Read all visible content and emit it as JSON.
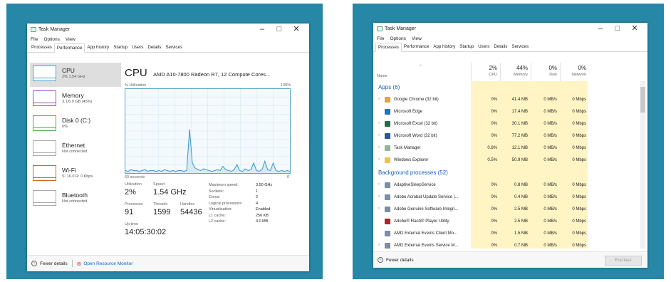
{
  "left": {
    "title": "Task Manager",
    "menu": [
      "File",
      "Options",
      "View"
    ],
    "tabs": [
      "Processes",
      "Performance",
      "App history",
      "Startup",
      "Users",
      "Details",
      "Services"
    ],
    "active_tab": "Performance",
    "sidebar": [
      {
        "name": "CPU",
        "sub": "2% 1.54 GHz",
        "color": "#4aa3d4"
      },
      {
        "name": "Memory",
        "sub": "3.1/6.9 GB (45%)",
        "color": "#a24dc4"
      },
      {
        "name": "Disk 0 (C:)",
        "sub": "0%",
        "color": "#4caf50"
      },
      {
        "name": "Ethernet",
        "sub": "Not connected",
        "color": "#aaaaaa"
      },
      {
        "name": "Wi-Fi",
        "sub": "S: 16.0 R: 0 Kbps",
        "color": "#d2691e"
      },
      {
        "name": "Bluetooth",
        "sub": "Not connected",
        "color": "#aaaaaa"
      }
    ],
    "main": {
      "title": "CPU",
      "model": "AMD A10-7800 Radeon R7, 12 Compute Cores...",
      "util_label": "% Utilization",
      "util_max": "100%",
      "time_label": "60 seconds",
      "time_end": "0",
      "utilization_label": "Utilization",
      "utilization": "2%",
      "speed_label": "Speed",
      "speed": "1.54 GHz",
      "processes_label": "Processes",
      "processes": "91",
      "threads_label": "Threads",
      "threads": "1599",
      "handles_label": "Handles",
      "handles": "54436",
      "uptime_label": "Up time",
      "uptime": "14:05:30:02",
      "details": [
        {
          "k": "Maximum speed:",
          "v": "3.50 GHz"
        },
        {
          "k": "Sockets:",
          "v": "1"
        },
        {
          "k": "Cores:",
          "v": "2"
        },
        {
          "k": "Logical processors:",
          "v": "4"
        },
        {
          "k": "Virtualization:",
          "v": "Enabled"
        },
        {
          "k": "L1 cache:",
          "v": "256 KB"
        },
        {
          "k": "L2 cache:",
          "v": "4.0 MB"
        }
      ],
      "graph_values": [
        3,
        2,
        4,
        3,
        3,
        2,
        3,
        4,
        2,
        3,
        3,
        2,
        3,
        2,
        4,
        3,
        2,
        3,
        2,
        3,
        3,
        2,
        3,
        52,
        12,
        6,
        4,
        3,
        5,
        4,
        3,
        2,
        3,
        4,
        3,
        8,
        4,
        3,
        2,
        4,
        10,
        3,
        2,
        5,
        3,
        4,
        12,
        3,
        2,
        4,
        14,
        4,
        3,
        12,
        3,
        2,
        3,
        2,
        3,
        2
      ]
    },
    "footer": {
      "fewer": "Fewer details",
      "monitor": "Open Resource Monitor"
    }
  },
  "right": {
    "title": "Task Manager",
    "menu": [
      "File",
      "Options",
      "View"
    ],
    "tabs": [
      "Processes",
      "Performance",
      "App history",
      "Startup",
      "Users",
      "Details",
      "Services"
    ],
    "active_tab": "Processes",
    "columns": [
      {
        "pct": "2%",
        "name": "CPU"
      },
      {
        "pct": "44%",
        "name": "Memory"
      },
      {
        "pct": "0%",
        "name": "Disk"
      },
      {
        "pct": "0%",
        "name": "Network"
      }
    ],
    "name_header": "Name",
    "apps_group": "Apps (6)",
    "apps": [
      {
        "name": "Google Chrome (32 bit)",
        "cpu": "0%",
        "mem": "41.4 MB",
        "disk": "0 MB/s",
        "net": "0 Mbps",
        "icon": "#e8a33c",
        "exp": true
      },
      {
        "name": "Microsoft Edge",
        "cpu": "0%",
        "mem": "17.4 MB",
        "disk": "0 MB/s",
        "net": "0 Mbps",
        "icon": "#1e73c8",
        "exp": false
      },
      {
        "name": "Microsoft Excel (32 bit)",
        "cpu": "0%",
        "mem": "30.1 MB",
        "disk": "0 MB/s",
        "net": "0 Mbps",
        "icon": "#1e7145",
        "exp": true
      },
      {
        "name": "Microsoft Word (32 bit)",
        "cpu": "0%",
        "mem": "77.2 MB",
        "disk": "0 MB/s",
        "net": "0 Mbps",
        "icon": "#2b579a",
        "exp": true
      },
      {
        "name": "Task Manager",
        "cpu": "0.8%",
        "mem": "12.1 MB",
        "disk": "0 MB/s",
        "net": "0 Mbps",
        "icon": "#8fb59b",
        "exp": true
      },
      {
        "name": "Windows Explorer",
        "cpu": "0.5%",
        "mem": "50.9 MB",
        "disk": "0 MB/s",
        "net": "0 Mbps",
        "icon": "#f2c14e",
        "exp": true
      }
    ],
    "bg_group": "Background processes (52)",
    "bg": [
      {
        "name": "AdaptiveSleepService",
        "cpu": "0%",
        "mem": "0.8 MB",
        "disk": "0 MB/s",
        "net": "0 Mbps",
        "icon": "#7a8ea8",
        "exp": true
      },
      {
        "name": "Adobe Acrobat Update Service (...",
        "cpu": "0%",
        "mem": "0.4 MB",
        "disk": "0 MB/s",
        "net": "0 Mbps",
        "icon": "#7a8ea8",
        "exp": true
      },
      {
        "name": "Adobe Genuine Software Integri...",
        "cpu": "0%",
        "mem": "2.5 MB",
        "disk": "0 MB/s",
        "net": "0 Mbps",
        "icon": "#7a8ea8",
        "exp": true
      },
      {
        "name": "Adobe® Flash® Player Utility",
        "cpu": "0%",
        "mem": "2.5 MB",
        "disk": "0 MB/s",
        "net": "0 Mbps",
        "icon": "#b22222",
        "exp": false
      },
      {
        "name": "AMD External Events Client Mo...",
        "cpu": "0%",
        "mem": "1.5 MB",
        "disk": "0 MB/s",
        "net": "0 Mbps",
        "icon": "#7a8ea8",
        "exp": false
      },
      {
        "name": "AMD External Events Service M...",
        "cpu": "0%",
        "mem": "0.7 MB",
        "disk": "0 MB/s",
        "net": "0 Mbps",
        "icon": "#7a8ea8",
        "exp": true
      }
    ],
    "footer": {
      "fewer": "Fewer details",
      "end_task": "End task"
    }
  }
}
